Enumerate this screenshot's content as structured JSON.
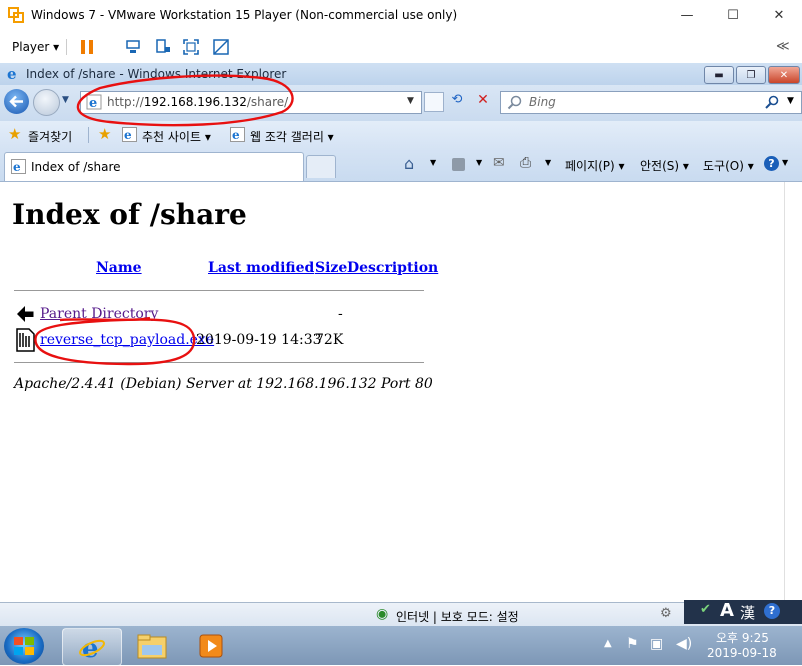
{
  "vmware": {
    "window_title": "Windows 7 - VMware Workstation 15 Player (Non-commercial use only)",
    "minimize": "—",
    "maximize": "☐",
    "close": "✕",
    "player_menu": "Player ▾",
    "collapse": "≪"
  },
  "ie": {
    "window_title": "Index of /share - Windows Internet Explorer",
    "address": {
      "scheme": "http://",
      "host": "192.168.196.132",
      "path": "/share/"
    },
    "search_placeholder": "Bing",
    "favorites_label": "즐겨찾기",
    "suggested_sites": "추천 사이트 ▾",
    "web_slice_gallery": "웹 조각 갤러리 ▾",
    "tab_title": "Index of /share",
    "cmd_page": "페이지(P) ▾",
    "cmd_safety": "안전(S) ▾",
    "cmd_tools": "도구(O) ▾",
    "status_text": "인터넷 | 보호 모드: 설정"
  },
  "page": {
    "heading": "Index of /share",
    "columns": {
      "name": "Name",
      "last_modified": "Last modified",
      "size": "Size",
      "description": "Description"
    },
    "rows": [
      {
        "name": "Parent Directory",
        "modified": "",
        "size": "-",
        "icon": "back-icon"
      },
      {
        "name": "reverse_tcp_payload.exe",
        "modified": "2019-09-19 14:33",
        "size": "72K",
        "icon": "binary-file-icon"
      }
    ],
    "footer": "Apache/2.4.41 (Debian) Server at 192.168.196.132 Port 80"
  },
  "taskbar": {
    "time": "오후 9:25",
    "date": "2019-09-18",
    "ime_a": "A",
    "ime_han": "漢"
  },
  "colors": {
    "annotation": "#e81010",
    "link": "#0000ee",
    "visited": "#551a8b"
  }
}
